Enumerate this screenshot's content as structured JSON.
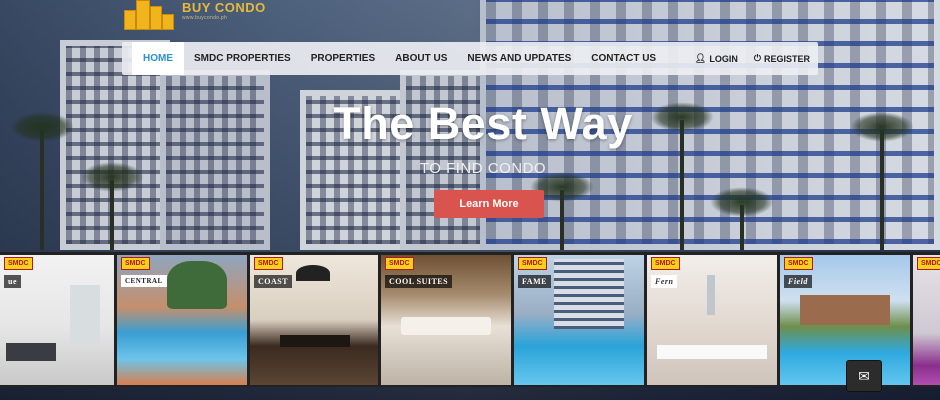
{
  "logo": {
    "name": "BUY CONDO",
    "tagline": "www.buycondo.ph",
    "icon": "building-logo-icon"
  },
  "nav": {
    "items": [
      {
        "label": "HOME",
        "active": true
      },
      {
        "label": "SMDC PROPERTIES",
        "active": false
      },
      {
        "label": "PROPERTIES",
        "active": false
      },
      {
        "label": "ABOUT US",
        "active": false
      },
      {
        "label": "NEWS AND UPDATES",
        "active": false
      },
      {
        "label": "CONTACT US",
        "active": false
      }
    ],
    "login": {
      "label": "LOGIN",
      "icon": "user-icon"
    },
    "register": {
      "label": "REGISTER",
      "icon": "power-icon"
    },
    "active_color": "#2b8fd6"
  },
  "hero": {
    "title": "The Best Way",
    "subtitle": "TO FIND CONDO",
    "cta": "Learn More",
    "cta_color": "#d9534f"
  },
  "properties": {
    "cards": [
      {
        "tag": "SMDC",
        "brand": "ue",
        "scene": "white-lobby"
      },
      {
        "tag": "SMDC",
        "brand": "CENTRAL",
        "scene": "pool-trees"
      },
      {
        "tag": "SMDC",
        "brand": "COAST",
        "scene": "dining-room"
      },
      {
        "tag": "SMDC",
        "brand": "COOL SUITES",
        "scene": "living-room"
      },
      {
        "tag": "SMDC",
        "brand": "FAME",
        "scene": "tower-pool"
      },
      {
        "tag": "SMDC",
        "brand": "Fern",
        "scene": "bright-lobby"
      },
      {
        "tag": "SMDC",
        "brand": "Field",
        "scene": "resort-pool"
      },
      {
        "tag": "SMDC",
        "brand": "",
        "scene": "interior-purple"
      }
    ]
  },
  "mail_button": {
    "icon": "envelope-icon"
  }
}
